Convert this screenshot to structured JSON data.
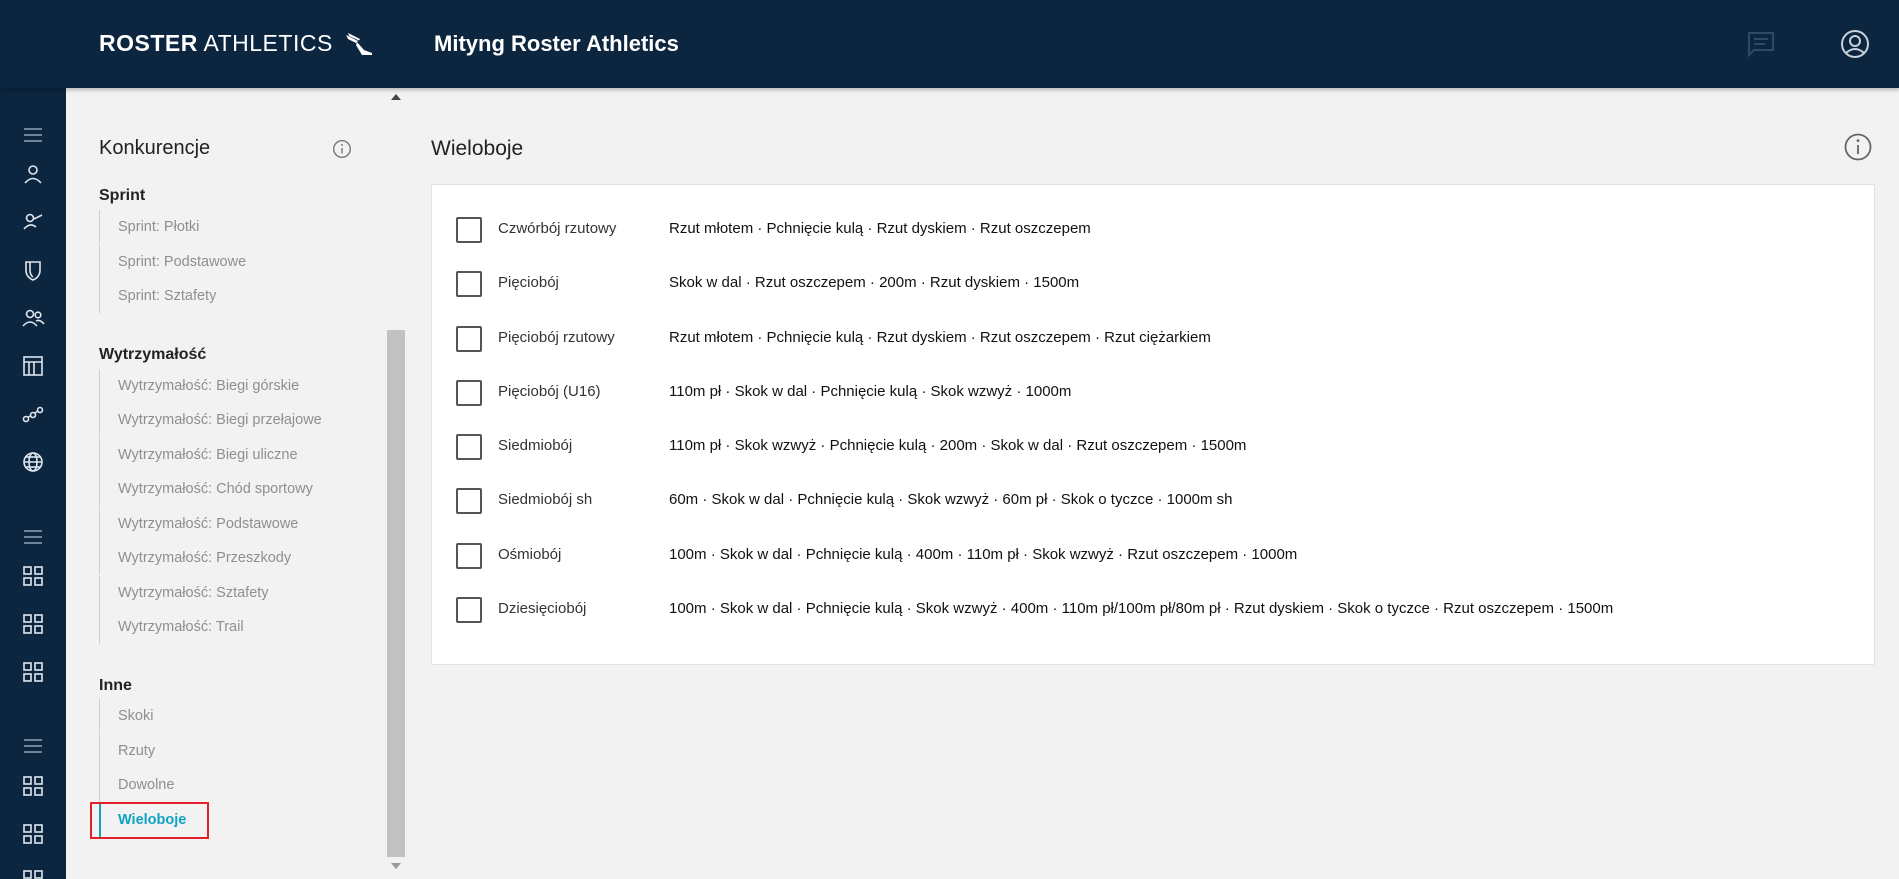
{
  "header": {
    "brand_bold": "ROSTER",
    "brand_light": "ATHLETICS",
    "title": "Mityng Roster Athletics",
    "icons": [
      "chat-icon",
      "account-icon"
    ]
  },
  "rail": {
    "icons": [
      "menu-icon",
      "person-icon",
      "coach-icon",
      "shield-icon",
      "group-icon",
      "calendar-icon",
      "relay-icon",
      "globe-icon",
      "menu-icon",
      "grid-icon",
      "grid-icon",
      "grid-icon",
      "menu-icon",
      "grid-icon",
      "grid-icon",
      "grid-icon"
    ]
  },
  "sidebar": {
    "title": "Konkurencje",
    "groups": [
      {
        "label": "Sprint",
        "items": [
          "Sprint: Płotki",
          "Sprint: Podstawowe",
          "Sprint: Sztafety"
        ]
      },
      {
        "label": "Wytrzymałość",
        "items": [
          "Wytrzymałość: Biegi górskie",
          "Wytrzymałość: Biegi przełajowe",
          "Wytrzymałość: Biegi uliczne",
          "Wytrzymałość: Chód sportowy",
          "Wytrzymałość: Podstawowe",
          "Wytrzymałość: Przeszkody",
          "Wytrzymałość: Sztafety",
          "Wytrzymałość: Trail"
        ]
      },
      {
        "label": "Inne",
        "items": [
          "Skoki",
          "Rzuty",
          "Dowolne",
          "Wieloboje"
        ]
      }
    ],
    "active_item": "Wieloboje"
  },
  "main": {
    "title": "Wieloboje",
    "rows": [
      {
        "name": "Czwórbój rzutowy",
        "events": "Rzut młotem · Pchnięcie kulą · Rzut dyskiem · Rzut oszczepem",
        "checked": false
      },
      {
        "name": "Pięciobój",
        "events": "Skok w dal · Rzut oszczepem · 200m · Rzut dyskiem · 1500m",
        "checked": false
      },
      {
        "name": "Pięciobój rzutowy",
        "events": "Rzut młotem · Pchnięcie kulą · Rzut dyskiem · Rzut oszczepem · Rzut ciężarkiem",
        "checked": false
      },
      {
        "name": "Pięciobój (U16)",
        "events": "110m pł · Skok w dal · Pchnięcie kulą · Skok wzwyż · 1000m",
        "checked": false
      },
      {
        "name": "Siedmiobój",
        "events": "110m pł · Skok wzwyż · Pchnięcie kulą · 200m · Skok w dal · Rzut oszczepem · 1500m",
        "checked": false
      },
      {
        "name": "Siedmiobój sh",
        "events": "60m · Skok w dal · Pchnięcie kulą · Skok wzwyż · 60m pł · Skok o tyczce · 1000m sh",
        "checked": false
      },
      {
        "name": "Ośmiobój",
        "events": "100m · Skok w dal · Pchnięcie kulą · 400m · 110m pł · Skok wzwyż · Rzut oszczepem · 1000m",
        "checked": false
      },
      {
        "name": "Dziesięciobój",
        "events": "100m · Skok w dal · Pchnięcie kulą · Skok wzwyż · 400m · 110m pł/100m pł/80m pł · Rzut dyskiem · Skok o tyczce · Rzut oszczepem · 1500m",
        "checked": false
      }
    ]
  },
  "colors": {
    "header_bg": "#0c2640",
    "accent": "#0fa3c2",
    "highlight": "#e3202a"
  }
}
